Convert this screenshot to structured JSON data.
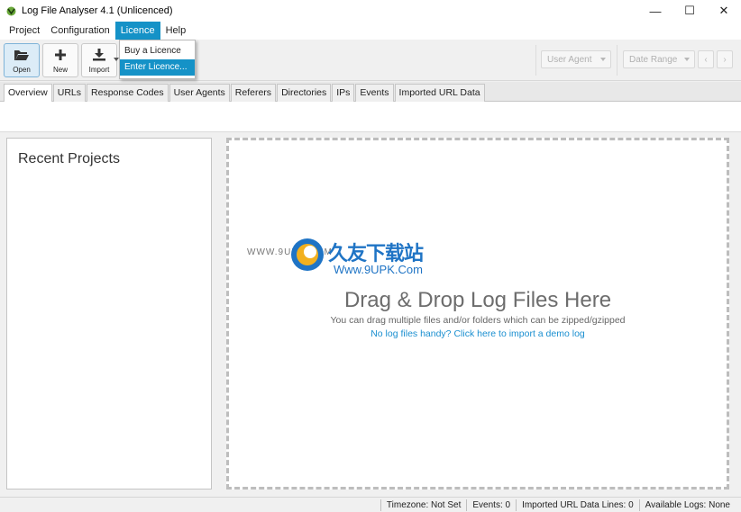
{
  "window": {
    "title": "Log File Analyser 4.1 (Unlicenced)",
    "controls": {
      "minimize": "—",
      "maximize": "☐",
      "close": "✕"
    }
  },
  "menu": {
    "items": [
      "Project",
      "Configuration",
      "Licence",
      "Help"
    ],
    "active": "Licence",
    "dropdown": [
      "Buy a Licence",
      "Enter Licence..."
    ]
  },
  "toolbar": {
    "open_label": "Open",
    "new_label": "New",
    "import_label": "Import",
    "user_agent": "User Agent",
    "date_range": "Date Range",
    "prev": "‹",
    "next": "›"
  },
  "tabs": [
    "Overview",
    "URLs",
    "Response Codes",
    "User Agents",
    "Referers",
    "Directories",
    "IPs",
    "Events",
    "Imported URL Data"
  ],
  "recent": {
    "title": "Recent Projects"
  },
  "dropzone": {
    "title": "Drag & Drop Log Files Here",
    "subtitle": "You can drag multiple files and/or folders which can be zipped/gzipped",
    "demo_link": "No log files handy? Click here to import a demo log"
  },
  "watermark": {
    "left_text": "WWW.9UPK.COM",
    "cn_text": "久友下载站",
    "url_text": "Www.9UPK.Com"
  },
  "status": {
    "timezone": "Timezone: Not Set",
    "events": "Events: 0",
    "imported": "Imported URL Data Lines: 0",
    "available": "Available Logs: None"
  },
  "colors": {
    "accent": "#1592c7",
    "link": "#1a8fd0",
    "watermark": "#1f74c5"
  }
}
